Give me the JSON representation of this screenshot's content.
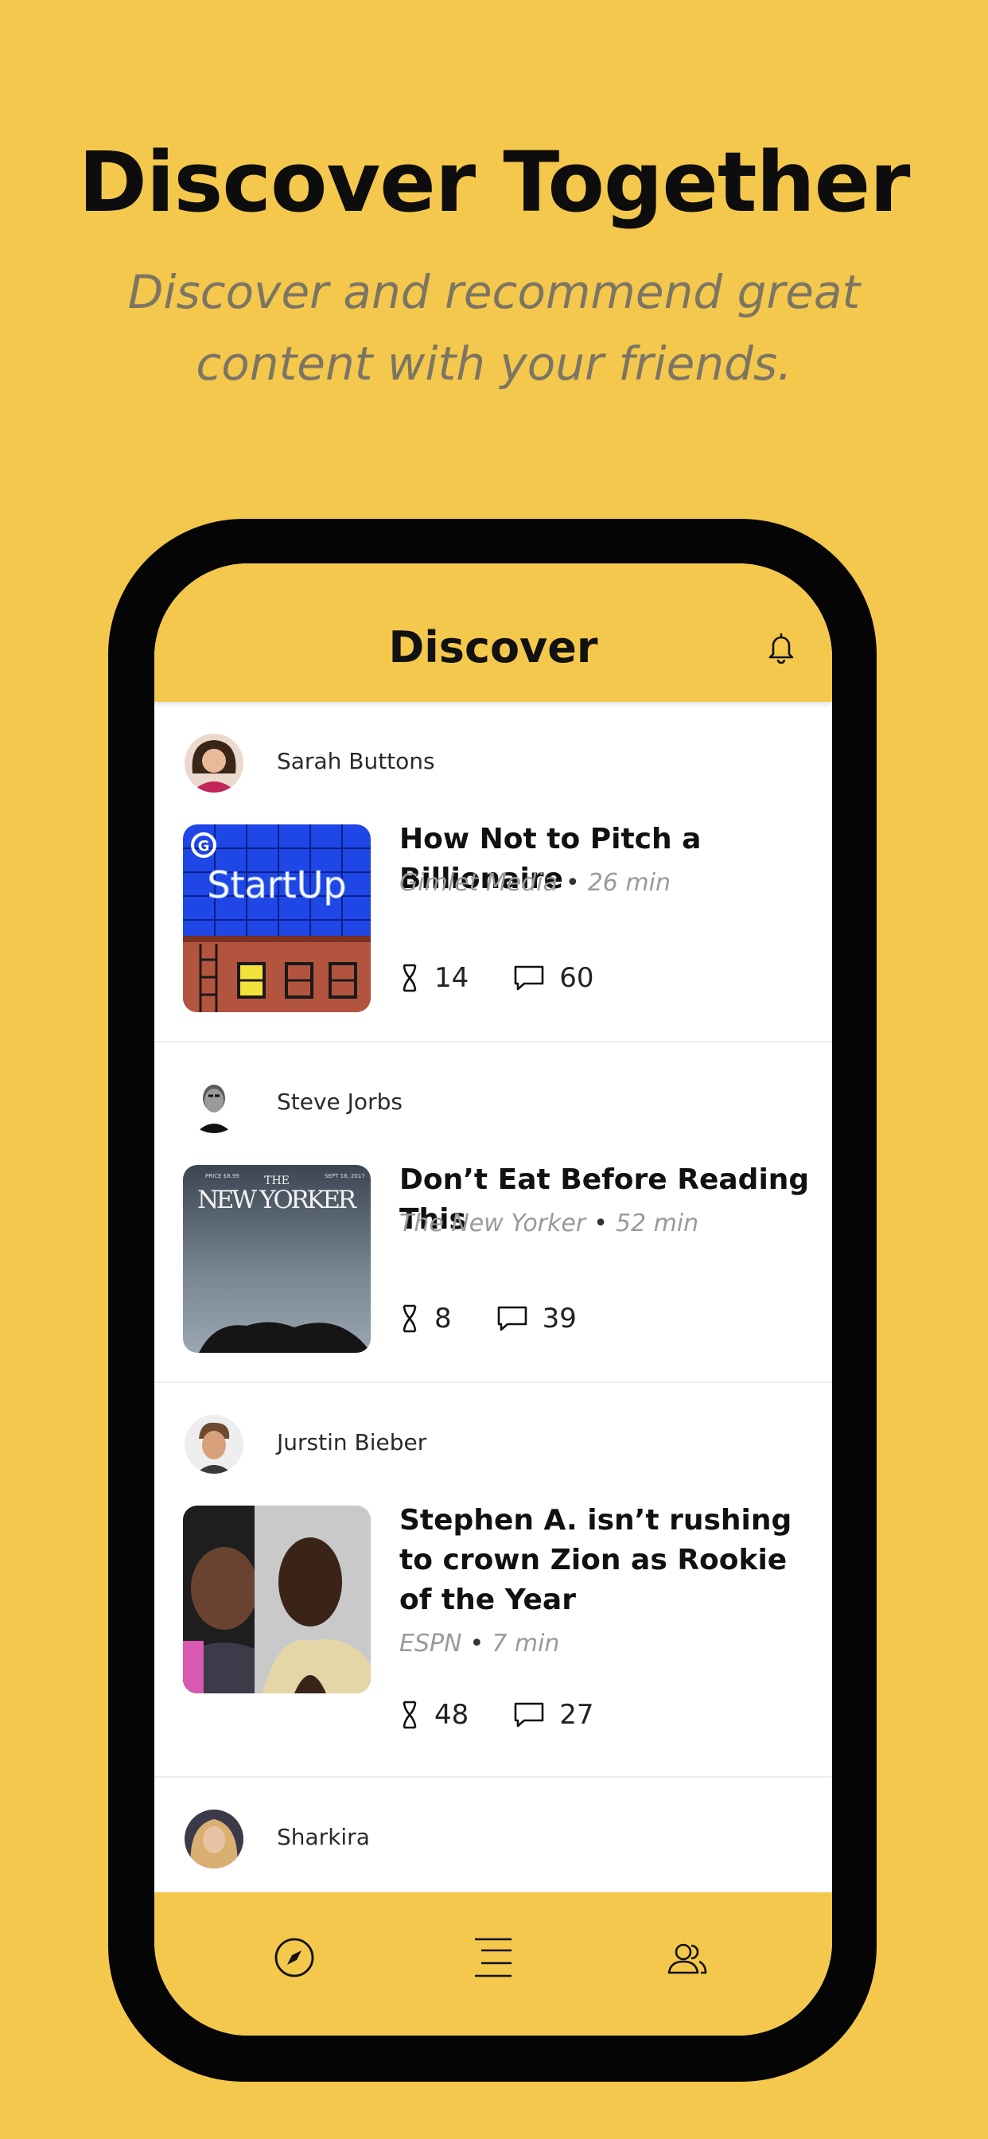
{
  "promo": {
    "headline": "Discover Together",
    "subline_1": "Discover and recommend great",
    "subline_2": "content with your friends."
  },
  "header": {
    "title": "Discover"
  },
  "feed": [
    {
      "user": "Sarah Buttons",
      "title": "How Not to Pitch a Billionaire",
      "source": "Gimlet Media",
      "duration": "26 min",
      "recommends": "14",
      "comments": "60",
      "thumb_text": "StartUp"
    },
    {
      "user": "Steve Jorbs",
      "title": "Don’t Eat Before Reading This",
      "source": "The New Yorker",
      "duration": "52 min",
      "recommends": "8",
      "comments": "39",
      "thumb_text": "NEW YORKER"
    },
    {
      "user": "Jurstin Bieber",
      "title": "Stephen A. isn’t rushing to crown Zion as Rookie of the Year",
      "source": "ESPN",
      "duration": "7 min",
      "recommends": "48",
      "comments": "27"
    },
    {
      "user": "Sharkira"
    }
  ],
  "icons": {
    "bell": "bell-icon",
    "recommend": "recommend-icon",
    "comment": "comment-icon",
    "discover": "compass-icon",
    "feed": "list-icon",
    "friends": "friends-icon"
  },
  "colors": {
    "background": "#F4C84C",
    "phone": "#050505",
    "meta": "#9a9a9a"
  }
}
